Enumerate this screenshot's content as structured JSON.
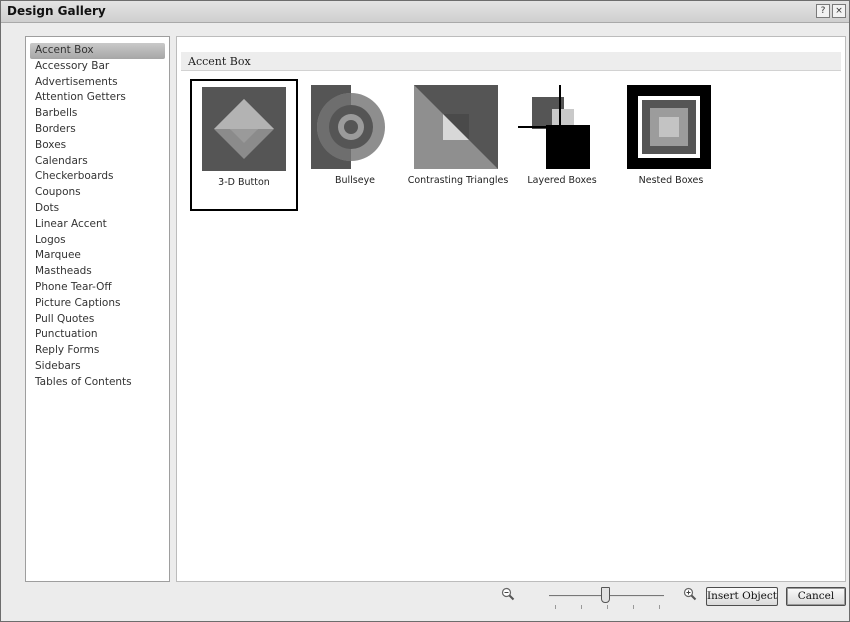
{
  "window": {
    "title": "Design Gallery"
  },
  "title_buttons": {
    "help": "?",
    "close": "×"
  },
  "sidebar": {
    "items": [
      "Accent Box",
      "Accessory Bar",
      "Advertisements",
      "Attention Getters",
      "Barbells",
      "Borders",
      "Boxes",
      "Calendars",
      "Checkerboards",
      "Coupons",
      "Dots",
      "Linear Accent",
      "Logos",
      "Marquee",
      "Mastheads",
      "Phone Tear-Off",
      "Picture Captions",
      "Pull Quotes",
      "Punctuation",
      "Reply Forms",
      "Sidebars",
      "Tables of Contents"
    ],
    "selected": "Accent Box"
  },
  "main": {
    "section_title": "Accent Box",
    "tiles": [
      {
        "label": "3-D Button",
        "selected": true
      },
      {
        "label": "Bullseye",
        "selected": false
      },
      {
        "label": "Contrasting Triangles",
        "selected": false
      },
      {
        "label": "Layered Boxes",
        "selected": false
      },
      {
        "label": "Nested Boxes",
        "selected": false
      }
    ]
  },
  "footer": {
    "zoom_out_icon": "magnifier-minus-icon",
    "zoom_in_icon": "magnifier-plus-icon",
    "insert_label": "Insert Object",
    "cancel_label": "Cancel"
  }
}
